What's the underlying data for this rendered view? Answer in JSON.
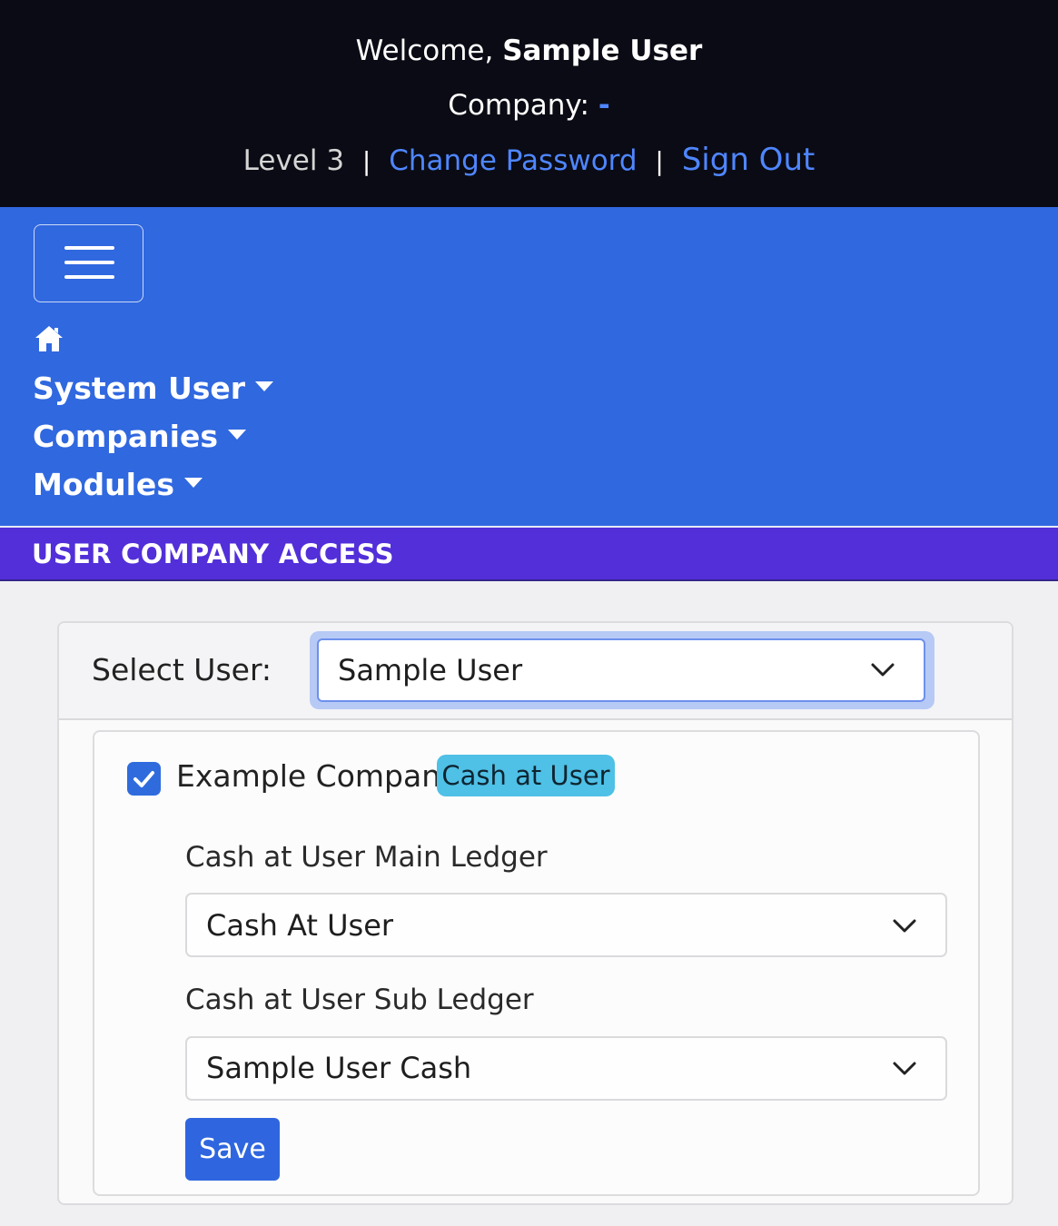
{
  "header": {
    "welcome_prefix": "Welcome,",
    "user_name": "Sample User",
    "company_label": "Company:",
    "company_value": "-",
    "level": "Level 3",
    "separator": "|",
    "change_password": "Change Password",
    "sign_out": "Sign Out"
  },
  "nav": {
    "menu_icon": "hamburger-menu-icon",
    "home_icon": "home-icon",
    "items": [
      {
        "label": "System User"
      },
      {
        "label": "Companies"
      },
      {
        "label": "Modules"
      }
    ]
  },
  "page": {
    "title": "USER COMPANY ACCESS"
  },
  "form": {
    "select_user_label": "Select User:",
    "selected_user": "Sample User",
    "company": {
      "checked": true,
      "name": "Example Company",
      "badge": "Cash at User"
    },
    "main_ledger_label": "Cash at User Main Ledger",
    "main_ledger_value": "Cash At User",
    "sub_ledger_label": "Cash at User Sub Ledger",
    "sub_ledger_value": "Sample User Cash",
    "save_label": "Save"
  },
  "colors": {
    "topbar_bg": "#0a0b14",
    "nav_bg": "#3068df",
    "header_bg": "#522fd9",
    "link": "#4f86ff",
    "badge_bg": "#4fc0e6",
    "primary": "#2f66df"
  }
}
